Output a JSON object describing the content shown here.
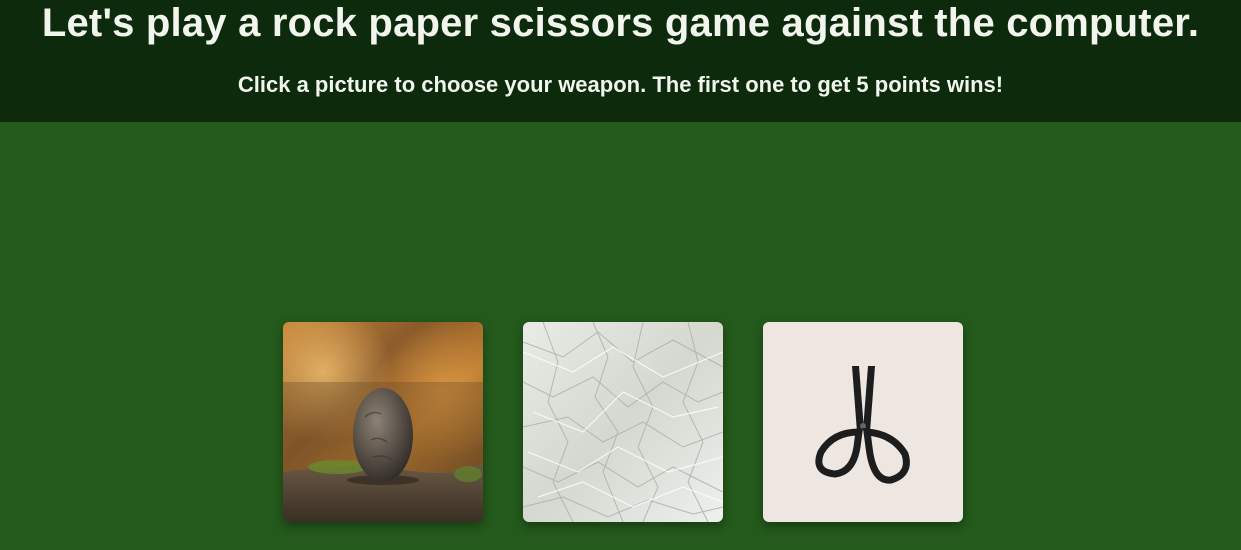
{
  "header": {
    "title": "Let's play a rock paper scissors game against the computer.",
    "subtitle": "Click a picture to choose your weapon. The first one to get 5 points wins!"
  },
  "choices": [
    {
      "name": "rock",
      "icon": "rock-image"
    },
    {
      "name": "paper",
      "icon": "paper-image"
    },
    {
      "name": "scissors",
      "icon": "scissors-image"
    }
  ],
  "colors": {
    "background": "#245a1c",
    "header_background": "#0d2a0c",
    "header_text": "#f1f5ee"
  }
}
